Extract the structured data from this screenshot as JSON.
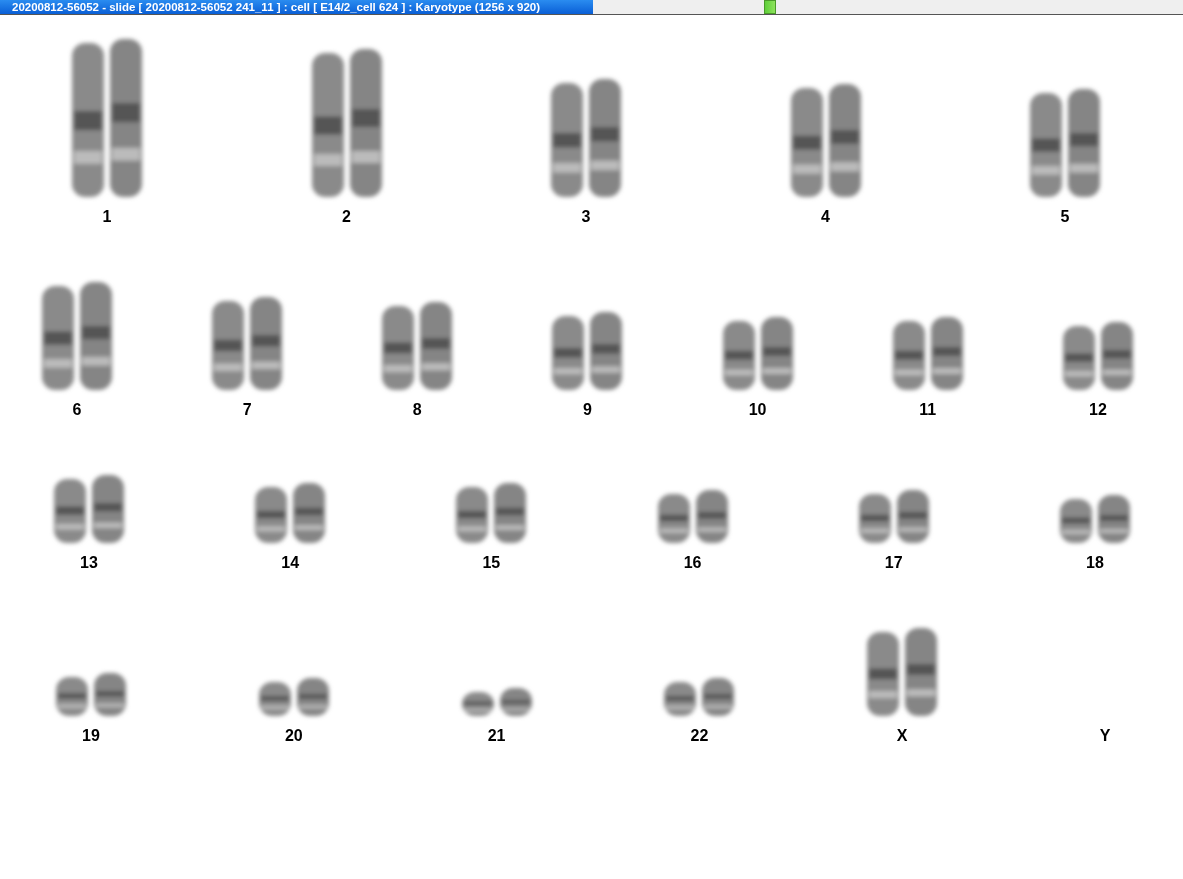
{
  "window": {
    "title": "20200812-56052 - slide [ 20200812-56052 241_11 ] : cell [ E14/2_cell 624 ] : Karyotype  (1256 x 920)"
  },
  "rows": [
    {
      "items": [
        {
          "label": "1",
          "kind": "pair"
        },
        {
          "label": "2",
          "kind": "pair"
        },
        {
          "label": "3",
          "kind": "pair"
        },
        {
          "label": "4",
          "kind": "pair"
        },
        {
          "label": "5",
          "kind": "pair"
        }
      ]
    },
    {
      "items": [
        {
          "label": "6",
          "kind": "pair"
        },
        {
          "label": "7",
          "kind": "pair"
        },
        {
          "label": "8",
          "kind": "pair"
        },
        {
          "label": "9",
          "kind": "pair"
        },
        {
          "label": "10",
          "kind": "pair"
        },
        {
          "label": "11",
          "kind": "pair"
        },
        {
          "label": "12",
          "kind": "pair"
        }
      ]
    },
    {
      "items": [
        {
          "label": "13",
          "kind": "pair"
        },
        {
          "label": "14",
          "kind": "pair"
        },
        {
          "label": "15",
          "kind": "pair"
        },
        {
          "label": "16",
          "kind": "pair"
        },
        {
          "label": "17",
          "kind": "pair"
        },
        {
          "label": "18",
          "kind": "pair"
        }
      ]
    },
    {
      "items": [
        {
          "label": "19",
          "kind": "pair"
        },
        {
          "label": "20",
          "kind": "pair"
        },
        {
          "label": "21",
          "kind": "pair"
        },
        {
          "label": "22",
          "kind": "pair"
        },
        {
          "label": "X",
          "kind": "pair"
        },
        {
          "label": "Y",
          "kind": "empty"
        }
      ]
    }
  ]
}
